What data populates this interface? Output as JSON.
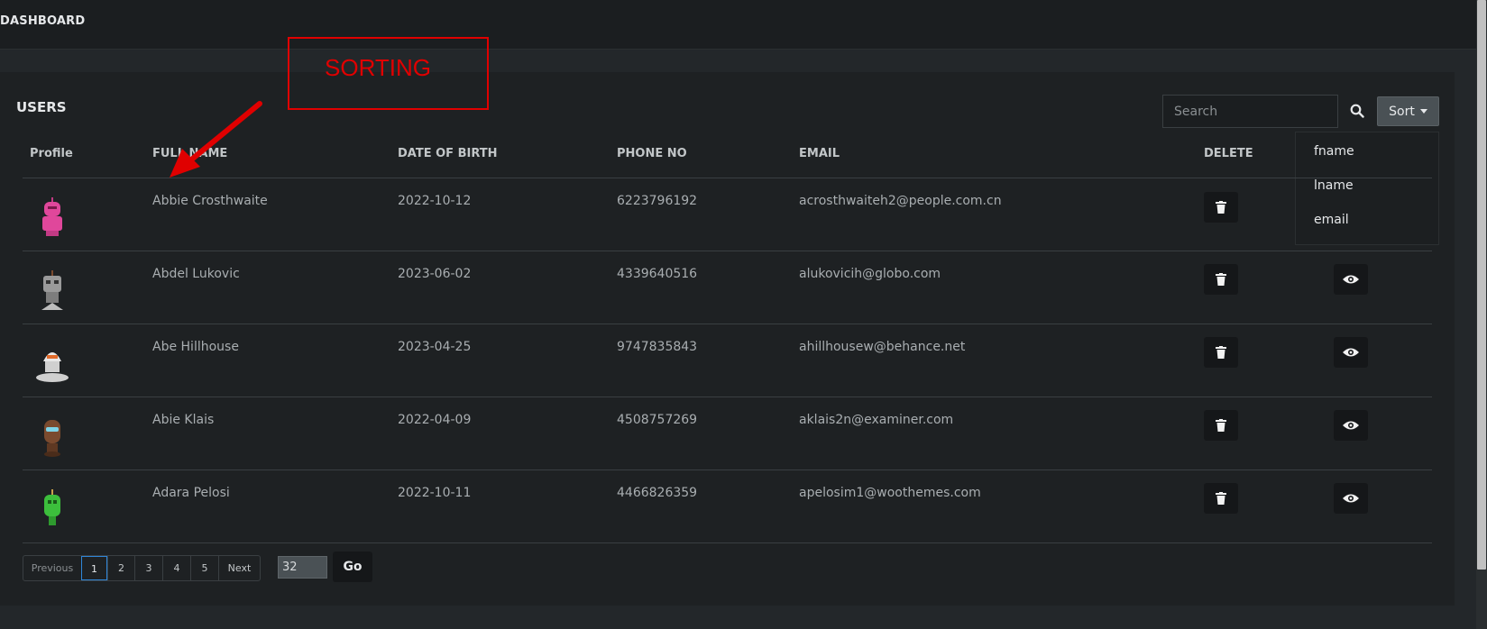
{
  "app": {
    "title": "DASHBOARD"
  },
  "card": {
    "title": "USERS"
  },
  "search": {
    "placeholder": "Search"
  },
  "sort": {
    "label": "Sort",
    "options": [
      "fname",
      "lname",
      "email"
    ]
  },
  "table": {
    "headers": {
      "profile": "Profile",
      "full_name": "FULL NAME",
      "dob": "DATE OF BIRTH",
      "phone": "PHONE NO",
      "email": "EMAIL",
      "delete": "DELETE"
    },
    "rows": [
      {
        "name": "Abbie Crosthwaite",
        "dob": "2022-10-12",
        "phone": "6223796192",
        "email": "acrosthwaiteh2@people.com.cn",
        "avatar_color": "#e0479b"
      },
      {
        "name": "Abdel Lukovic",
        "dob": "2023-06-02",
        "phone": "4339640516",
        "email": "alukovicih@globo.com",
        "avatar_color": "#9a9a9a"
      },
      {
        "name": "Abe Hillhouse",
        "dob": "2023-04-25",
        "phone": "9747835843",
        "email": "ahillhousew@behance.net",
        "avatar_color": "#e8e8e8"
      },
      {
        "name": "Abie Klais",
        "dob": "2022-04-09",
        "phone": "4508757269",
        "email": "aklais2n@examiner.com",
        "avatar_color": "#7a4a2e"
      },
      {
        "name": "Adara Pelosi",
        "dob": "2022-10-11",
        "phone": "4466826359",
        "email": "apelosim1@woothemes.com",
        "avatar_color": "#3cbf3c"
      }
    ]
  },
  "pagination": {
    "previous": "Previous",
    "pages": [
      "1",
      "2",
      "3",
      "4",
      "5"
    ],
    "active": "1",
    "next": "Next",
    "jump_value": "32",
    "go_label": "Go"
  },
  "annotation": {
    "text": "SORTING",
    "color": "#e00000"
  },
  "colors": {
    "accent": "#2f86d8",
    "background": "#23272a",
    "card": "#1e2123"
  },
  "icons": {
    "search": "search-icon",
    "delete": "trash-icon",
    "view": "eye-icon",
    "sort_caret": "caret-down-icon"
  }
}
